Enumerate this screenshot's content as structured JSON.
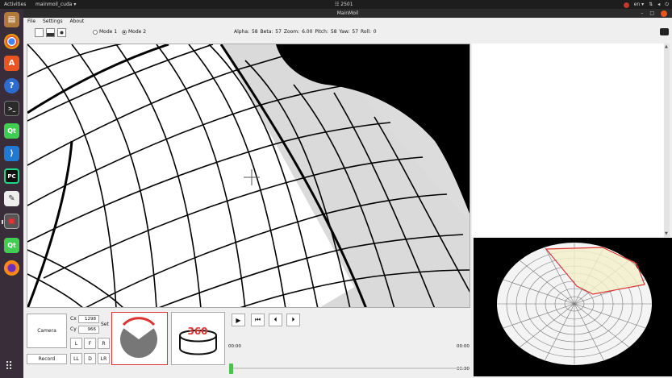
{
  "topbar": {
    "activities": "Activities",
    "app_menu": "mainmoil_cuda ▾",
    "clock": "☷ 2501",
    "lang": "en ▾"
  },
  "window": {
    "title": "MainMoil"
  },
  "menu": {
    "items": [
      "File",
      "Settings",
      "About"
    ]
  },
  "toolbar": {
    "mode1": "Mode 1",
    "mode2": "Mode 2",
    "selected_mode": "Mode 2",
    "params": "Alpha: 58  Beta: 57  Zoom: 6.00  Pitch: 58  Yaw: 57  Roll: 0"
  },
  "controls": {
    "camera_label": "Camera",
    "record_label": "Record",
    "cx_label": "Cx",
    "cy_label": "Cy",
    "cx_value": "1298",
    "cy_value": "966",
    "set_label": "Set",
    "dir_buttons": [
      "L",
      "F",
      "R",
      "LL",
      "D",
      "LR"
    ],
    "pano_text": "360",
    "time_start": "00:00",
    "time_end": "00:00",
    "time_left": "00:00",
    "progress": 0.0
  },
  "dock": {
    "apps": [
      "files-app",
      "chrome-app",
      "software-app",
      "help-app",
      "terminal-app",
      "qt-app",
      "vscode-app",
      "pycharm-app",
      "editor-app",
      "mainmoil-app",
      "qt-designer-app",
      "firefox-app"
    ]
  },
  "colors": {
    "accent_red": "#d33333",
    "slider_green": "#4fc04f",
    "dock_bg": "#3a2d3a",
    "ubuntu_orange": "#e95420"
  }
}
